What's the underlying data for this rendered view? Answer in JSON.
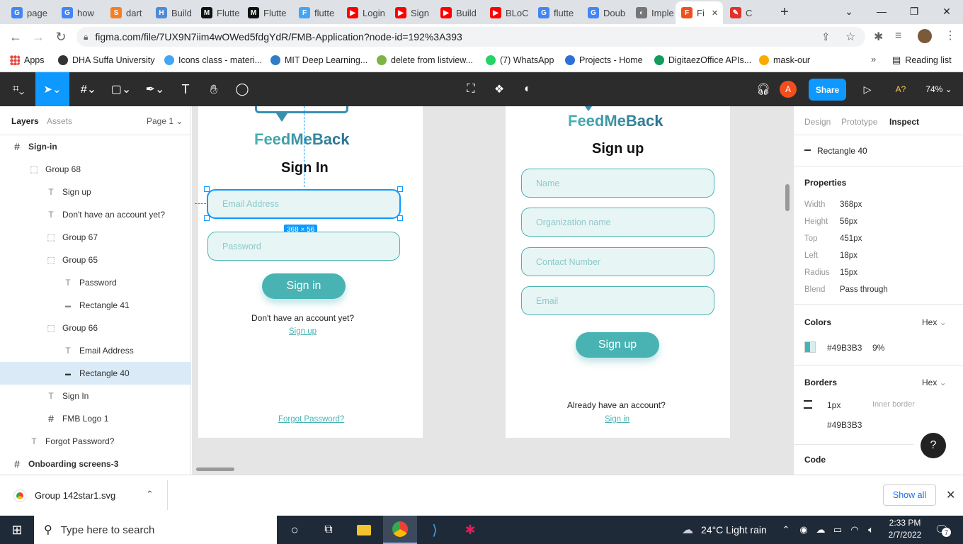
{
  "browser": {
    "tabs": [
      {
        "label": "page",
        "color": "#4285f4",
        "glyph": "G"
      },
      {
        "label": "how",
        "color": "#4285f4",
        "glyph": "G"
      },
      {
        "label": "dart",
        "color": "#f48024",
        "glyph": "S"
      },
      {
        "label": "Build",
        "color": "#4f8bd6",
        "glyph": "H"
      },
      {
        "label": "Flutte",
        "color": "#111111",
        "glyph": "M"
      },
      {
        "label": "Flutte",
        "color": "#111111",
        "glyph": "M"
      },
      {
        "label": "flutte",
        "color": "#42a5f5",
        "glyph": "F"
      },
      {
        "label": "Login",
        "color": "#ff0000",
        "glyph": "▶"
      },
      {
        "label": "Sign",
        "color": "#ff0000",
        "glyph": "▶"
      },
      {
        "label": "Build",
        "color": "#ff0000",
        "glyph": "▶"
      },
      {
        "label": "BLoC",
        "color": "#ff0000",
        "glyph": "▶"
      },
      {
        "label": "flutte",
        "color": "#4285f4",
        "glyph": "G"
      },
      {
        "label": "Doub",
        "color": "#4285f4",
        "glyph": "G"
      },
      {
        "label": "Imple",
        "color": "#777777",
        "glyph": "◐"
      },
      {
        "label": "Fi",
        "color": "#f24e1e",
        "glyph": "F"
      },
      {
        "label": "C",
        "color": "#e0312b",
        "glyph": "✎"
      }
    ],
    "url": "figma.com/file/7UX9N7iim4wOWed5fdgYdR/FMB-Application?node-id=192%3A393",
    "bookmarks": [
      {
        "label": "Apps",
        "color": "#e8453c"
      },
      {
        "label": "DHA Suffa University",
        "color": "#333333"
      },
      {
        "label": "Icons class - materi...",
        "color": "#42a5f5"
      },
      {
        "label": "MIT Deep Learning...",
        "color": "#2f7dc6"
      },
      {
        "label": "delete from listview...",
        "color": "#7cb342"
      },
      {
        "label": "(7) WhatsApp",
        "color": "#25d366"
      },
      {
        "label": "Projects - Home",
        "color": "#2e6fd8"
      },
      {
        "label": "DigitaezOffice APIs...",
        "color": "#0f9d58"
      },
      {
        "label": "mask-our",
        "color": "#f9ab00"
      }
    ],
    "reading_list": "Reading list"
  },
  "figma": {
    "zoom": "74%",
    "share_label": "Share",
    "avatar_letter": "A",
    "font_warning": "A?",
    "left_tabs": {
      "layers": "Layers",
      "assets": "Assets",
      "page": "Page 1"
    },
    "layers": [
      {
        "label": "Sign-in",
        "type": "frame",
        "indent": 0,
        "bold": true
      },
      {
        "label": "Group 68",
        "type": "group",
        "indent": 1
      },
      {
        "label": "Sign up",
        "type": "text",
        "indent": 2
      },
      {
        "label": "Don't have an account yet?",
        "type": "text",
        "indent": 2
      },
      {
        "label": "Group 67",
        "type": "group",
        "indent": 2
      },
      {
        "label": "Group 65",
        "type": "group",
        "indent": 2
      },
      {
        "label": "Password",
        "type": "text",
        "indent": 3
      },
      {
        "label": "Rectangle 41",
        "type": "rect",
        "indent": 3
      },
      {
        "label": "Group 66",
        "type": "group",
        "indent": 2
      },
      {
        "label": "Email Address",
        "type": "text",
        "indent": 3
      },
      {
        "label": "Rectangle 40",
        "type": "rect",
        "indent": 3,
        "selected": true
      },
      {
        "label": "Sign In",
        "type": "text",
        "indent": 2
      },
      {
        "label": "FMB Logo 1",
        "type": "frame",
        "indent": 2
      },
      {
        "label": "Forgot Password?",
        "type": "text",
        "indent": 1
      },
      {
        "label": "Onboarding screens-3",
        "type": "frame",
        "indent": 0,
        "bold": true
      }
    ],
    "signin": {
      "logo": "FeedMeBack",
      "title": "Sign In",
      "email_placeholder": "Email Address",
      "password_placeholder": "Password",
      "size_badge": "368 × 56",
      "button": "Sign in",
      "no_account": "Don't have an account yet?",
      "signup_link": "Sign up",
      "forgot": "Forgot Password?"
    },
    "signup": {
      "logo": "FeedMeBack",
      "title": "Sign up",
      "fields": [
        "Name",
        "Organization name",
        "Contact Number",
        "Email"
      ],
      "button": "Sign up",
      "have_account": "Already have an account?",
      "signin_link": "Sign in"
    },
    "inspect": {
      "tabs": [
        "Design",
        "Prototype",
        "Inspect"
      ],
      "selected": "Rectangle 40",
      "properties_title": "Properties",
      "properties": [
        {
          "k": "Width",
          "v": "368px"
        },
        {
          "k": "Height",
          "v": "56px"
        },
        {
          "k": "Top",
          "v": "451px"
        },
        {
          "k": "Left",
          "v": "18px"
        },
        {
          "k": "Radius",
          "v": "15px"
        },
        {
          "k": "Blend",
          "v": "Pass through"
        }
      ],
      "colors_title": "Colors",
      "colors_mode": "Hex",
      "color_hex": "#49B3B3",
      "color_opacity": "9%",
      "borders_title": "Borders",
      "borders_mode": "Hex",
      "border_width": "1px",
      "border_type": "Inner border",
      "border_hex": "#49B3B3",
      "code_title": "Code"
    }
  },
  "download": {
    "file": "Group 142star1.svg",
    "show_all": "Show all"
  },
  "taskbar": {
    "search_placeholder": "Type here to search",
    "weather": "24°C  Light rain",
    "time": "2:33 PM",
    "date": "2/7/2022",
    "notifications": "7"
  },
  "colors": {
    "accent": "#49b3b3",
    "figma_blue": "#0d99ff",
    "toolbar": "#2c2c2c"
  }
}
